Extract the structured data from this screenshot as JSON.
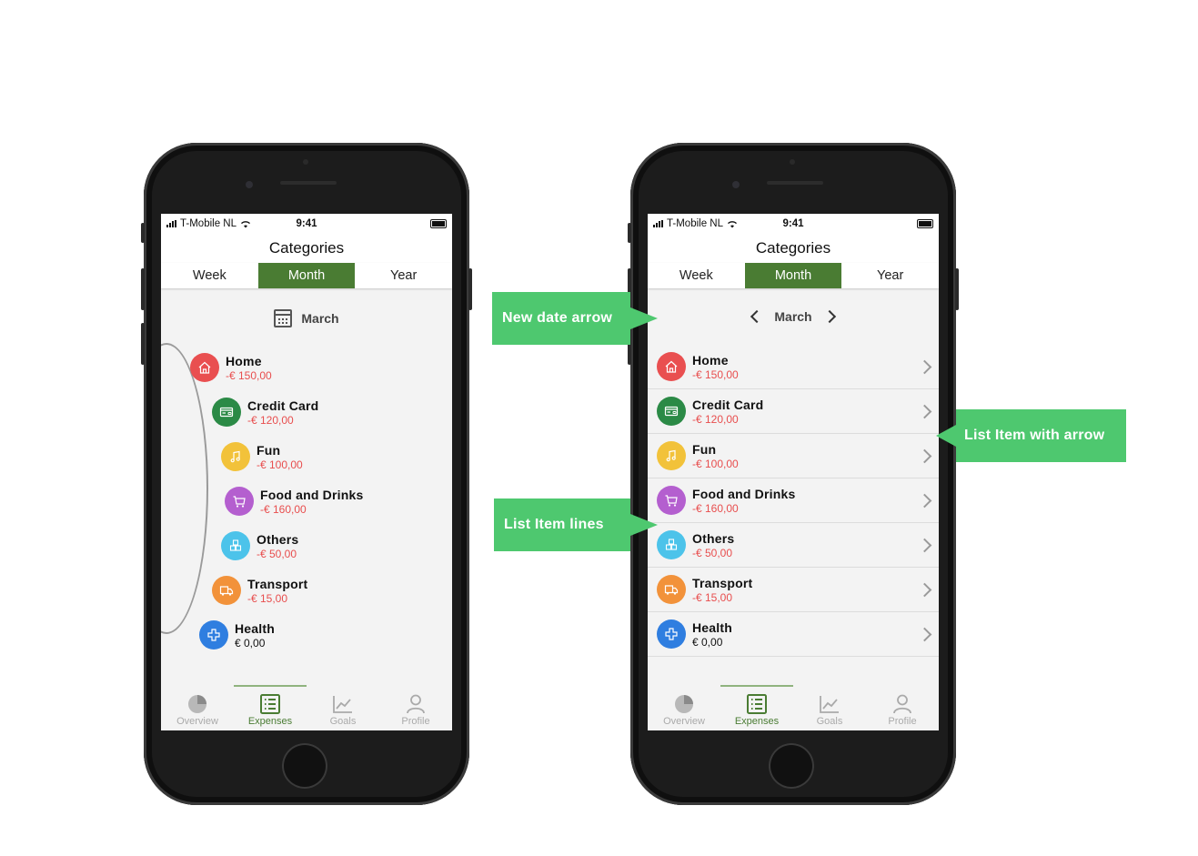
{
  "status": {
    "carrier": "T-Mobile NL",
    "time": "9:41"
  },
  "header": {
    "title": "Categories"
  },
  "tabs": [
    "Week",
    "Month",
    "Year"
  ],
  "active_tab": "Month",
  "date": {
    "month": "March"
  },
  "categories": [
    {
      "name": "Home",
      "amount": "-€ 150,00",
      "color": "#e94f50",
      "icon": "home-icon"
    },
    {
      "name": "Credit Card",
      "amount": "-€ 120,00",
      "color": "#2b8a46",
      "icon": "credit-card-icon"
    },
    {
      "name": "Fun",
      "amount": "-€ 100,00",
      "color": "#f2c23a",
      "icon": "music-note-icon"
    },
    {
      "name": "Food and Drinks",
      "amount": "-€ 160,00",
      "color": "#b45fcf",
      "icon": "shopping-cart-icon"
    },
    {
      "name": "Others",
      "amount": "-€ 50,00",
      "color": "#4cc3ea",
      "icon": "cubes-icon"
    },
    {
      "name": "Transport",
      "amount": "-€ 15,00",
      "color": "#f2923a",
      "icon": "truck-icon"
    },
    {
      "name": "Health",
      "amount": "€ 0,00",
      "color": "#2f7ee0",
      "icon": "health-cross-icon"
    }
  ],
  "tabbar": [
    {
      "label": "Overview",
      "icon": "pie-chart-icon"
    },
    {
      "label": "Expenses",
      "icon": "list-icon"
    },
    {
      "label": "Goals",
      "icon": "line-chart-icon"
    },
    {
      "label": "Profile",
      "icon": "user-icon"
    }
  ],
  "active_tabbar": "Expenses",
  "callouts": {
    "date_arrow": "New date arrow",
    "list_lines": "List Item lines",
    "list_arrow": "List Item with arrow"
  },
  "colors": {
    "accent": "#4a7c33",
    "callout": "#4ec86f",
    "negative": "#e84e4e"
  }
}
